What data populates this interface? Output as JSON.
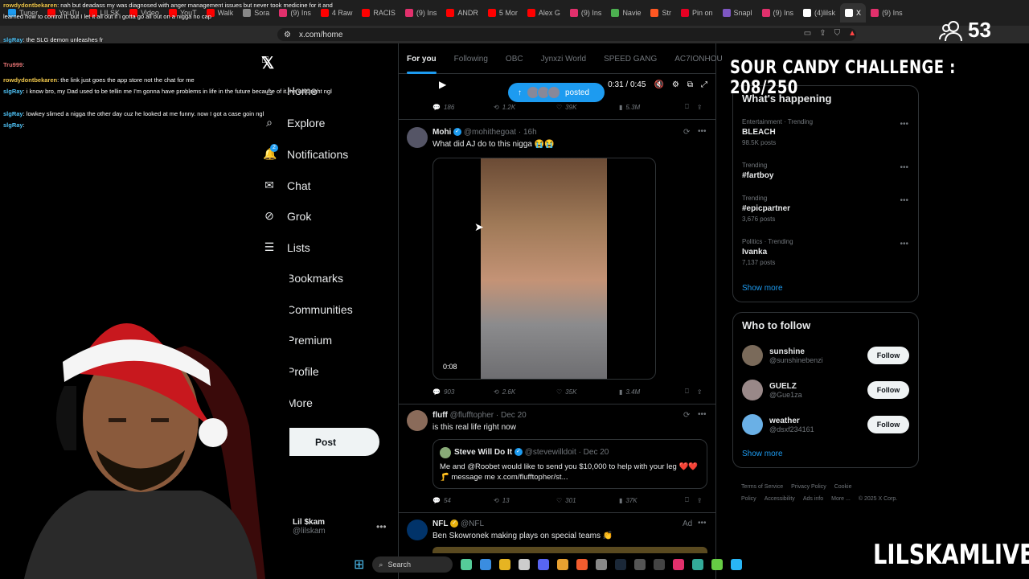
{
  "browser": {
    "tabs": [
      {
        "label": "Tuner",
        "color": "#1d9bf0"
      },
      {
        "label": "YouTu",
        "color": "#ff0000"
      },
      {
        "label": "LILSK",
        "color": "#ff0000"
      },
      {
        "label": "Video",
        "color": "#ff0000"
      },
      {
        "label": "YouT",
        "color": "#ff0000"
      },
      {
        "label": "Walk",
        "color": "#ff0000"
      },
      {
        "label": "Sora",
        "color": "#888888"
      },
      {
        "label": "(9) Ins",
        "color": "#e1306c"
      },
      {
        "label": "4 Raw",
        "color": "#ff0000"
      },
      {
        "label": "RACIS",
        "color": "#ff0000"
      },
      {
        "label": "(9) Ins",
        "color": "#e1306c"
      },
      {
        "label": "ANDR",
        "color": "#ff0000"
      },
      {
        "label": "5 Mor",
        "color": "#ff0000"
      },
      {
        "label": "Alex G",
        "color": "#ff0000"
      },
      {
        "label": "(9) Ins",
        "color": "#e1306c"
      },
      {
        "label": "Navie",
        "color": "#4caf50"
      },
      {
        "label": "Str",
        "color": "#ff5722"
      },
      {
        "label": "Pin on",
        "color": "#e60023"
      },
      {
        "label": "Snapl",
        "color": "#7e57c2"
      },
      {
        "label": "(9) Ins",
        "color": "#e1306c"
      },
      {
        "label": "(4)lilsk",
        "color": "#ffffff"
      },
      {
        "label": "X",
        "color": "#ffffff"
      },
      {
        "label": "(9) Ins",
        "color": "#e1306c"
      }
    ],
    "url": "x.com/home"
  },
  "stream": {
    "viewer_count": "53",
    "challenge": "SOUR CANDY CHALLENGE : 208/250",
    "brand": "LILSKAMLIVE"
  },
  "chat": [
    {
      "user": "rowdydontbekaren",
      "text": ": nah but deadass my was diagnosed with anger management issues but never took medicine for it and learned how to control it. but I let it all out if i gotta go all out on a nigga no cap",
      "color": "#f2c94c"
    },
    {
      "user": "slgRay",
      "text": ": the SLG demon unleashes fr",
      "color": "#4fc3f7"
    },
    {
      "user": "Tru999",
      "text": ":",
      "color": "#e57373"
    },
    {
      "user": "rowdydontbekaren",
      "text": ": the link just goes the app store not the chat for me",
      "color": "#f2c94c"
    },
    {
      "user": "slgRay",
      "text": ": i know bro, my Dad used to be tellin me I'm gonna have problems in life in the future because of it. he was right ngl",
      "color": "#4fc3f7"
    },
    {
      "user": "slgRay",
      "text": ": lowkey slimed a nigga the other day cuz he looked at me funny. now I got a case goin ngl",
      "color": "#4fc3f7"
    },
    {
      "user": "slgRay",
      "text": ":",
      "color": "#4fc3f7"
    }
  ],
  "nav": {
    "items": [
      {
        "label": "Home",
        "icon": "home-icon"
      },
      {
        "label": "Explore",
        "icon": "search-icon"
      },
      {
        "label": "Notifications",
        "icon": "bell-icon"
      },
      {
        "label": "Chat",
        "icon": "mail-icon"
      },
      {
        "label": "Grok",
        "icon": "grok-icon"
      },
      {
        "label": "Lists",
        "icon": "list-icon"
      },
      {
        "label": "Bookmarks",
        "icon": "bookmark-icon"
      },
      {
        "label": "Communities",
        "icon": "people-icon"
      },
      {
        "label": "Premium",
        "icon": "x-icon"
      },
      {
        "label": "Profile",
        "icon": "person-icon"
      },
      {
        "label": "More",
        "icon": "more-circle-icon"
      }
    ],
    "post_label": "Post",
    "notif_badge": "2",
    "account_name": "Lil $kam",
    "account_handle": "@lilskam"
  },
  "feed": {
    "tabs": [
      "For you",
      "Following",
      "OBC",
      "Jynxzi World",
      "SPEED GANG",
      "AC7IONHOU"
    ],
    "top_video": {
      "time": "0:31 / 0:45"
    },
    "posted_pill": "posted",
    "top_actions": {
      "replies": "186",
      "reposts": "1.2K",
      "likes": "39K",
      "views": "5.3M"
    },
    "tweets": [
      {
        "name": "Mohi",
        "handle": "@mohithegoat",
        "time": "16h",
        "text": "What did AJ do to this nigga 😭😭",
        "video_time": "0:08",
        "replies": "903",
        "reposts": "2.6K",
        "likes": "35K",
        "views": "3.4M"
      },
      {
        "name": "fluff",
        "handle": "@flufftopher",
        "time": "Dec 20",
        "text": "is this real life right now",
        "quote": {
          "name": "Steve Will Do It",
          "handle": "@stevewilldoit",
          "time": "Dec 20",
          "text": "Me and @Roobet would like to send you $10,000 to help with your leg ❤️❤️🦵 message me x.com/flufftopher/st..."
        },
        "replies": "54",
        "reposts": "13",
        "likes": "301",
        "views": "37K"
      },
      {
        "name": "NFL",
        "handle": "@NFL",
        "time": "Ad",
        "text": "Ben Skowronek making plays on special teams 👏"
      }
    ]
  },
  "trends": {
    "title": "What's happening",
    "items": [
      {
        "meta": "Entertainment · Trending",
        "name": "BLEACH",
        "posts": "98.5K posts"
      },
      {
        "meta": "Trending",
        "name": "#fartboy",
        "posts": ""
      },
      {
        "meta": "Trending",
        "name": "#epicpartner",
        "posts": "3,676 posts"
      },
      {
        "meta": "Politics · Trending",
        "name": "Ivanka",
        "posts": "7,137 posts"
      }
    ],
    "show_more": "Show more"
  },
  "who_to_follow": {
    "title": "Who to follow",
    "users": [
      {
        "name": "sunshine",
        "handle": "@sunshinebenzi",
        "button": "Follow"
      },
      {
        "name": "GUELZ",
        "handle": "@Gue1za",
        "button": "Follow"
      },
      {
        "name": "weather",
        "handle": "@dsxf234161",
        "button": "Follow"
      }
    ],
    "show_more": "Show more"
  },
  "footer": [
    "Terms of Service",
    "Privacy Policy",
    "Cookie Policy",
    "Accessibility",
    "Ads info",
    "More ...",
    "© 2025 X Corp."
  ],
  "taskbar": {
    "search": "Search"
  }
}
